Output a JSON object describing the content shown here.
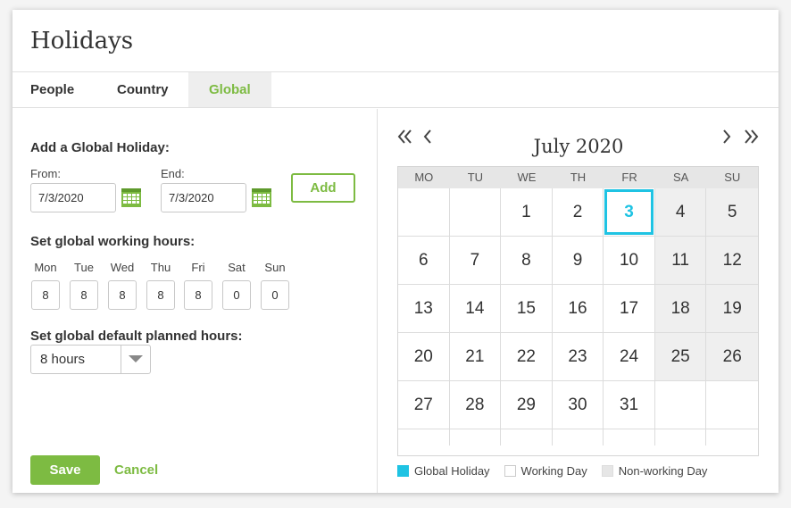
{
  "title": "Holidays",
  "tabs": [
    {
      "label": "People",
      "active": false
    },
    {
      "label": "Country",
      "active": false
    },
    {
      "label": "Global",
      "active": true
    }
  ],
  "add_holiday": {
    "title": "Add a Global Holiday:",
    "from_label": "From:",
    "from_value": "7/3/2020",
    "end_label": "End:",
    "end_value": "7/3/2020",
    "add_label": "Add",
    "calendar_icon": "calendar-icon"
  },
  "working_hours": {
    "title": "Set global working hours:",
    "days": [
      {
        "day": "Mon",
        "hours": "8"
      },
      {
        "day": "Tue",
        "hours": "8"
      },
      {
        "day": "Wed",
        "hours": "8"
      },
      {
        "day": "Thu",
        "hours": "8"
      },
      {
        "day": "Fri",
        "hours": "8"
      },
      {
        "day": "Sat",
        "hours": "0"
      },
      {
        "day": "Sun",
        "hours": "0"
      }
    ]
  },
  "planned_hours": {
    "title": "Set global default planned hours:",
    "selected": "8 hours"
  },
  "actions": {
    "save": "Save",
    "cancel": "Cancel"
  },
  "calendar": {
    "month_title": "July 2020",
    "weekdays": [
      "MO",
      "TU",
      "WE",
      "TH",
      "FR",
      "SA",
      "SU"
    ],
    "weeks": [
      [
        "",
        "",
        "1",
        "2",
        "3",
        "4",
        "5"
      ],
      [
        "6",
        "7",
        "8",
        "9",
        "10",
        "11",
        "12"
      ],
      [
        "13",
        "14",
        "15",
        "16",
        "17",
        "18",
        "19"
      ],
      [
        "20",
        "21",
        "22",
        "23",
        "24",
        "25",
        "26"
      ],
      [
        "27",
        "28",
        "29",
        "30",
        "31",
        "",
        ""
      ]
    ],
    "holidays": [
      "3"
    ],
    "nonworking_weekday_columns": [
      5,
      6
    ],
    "colors": {
      "holiday": "#1fc3e3",
      "nonworking": "#efefef",
      "accent": "#7dbb42"
    }
  },
  "legend": [
    {
      "label": "Global Holiday",
      "color": "#1fc3e3"
    },
    {
      "label": "Working Day",
      "color": "#ffffff"
    },
    {
      "label": "Non-working Day",
      "color": "#e6e6e6"
    }
  ]
}
